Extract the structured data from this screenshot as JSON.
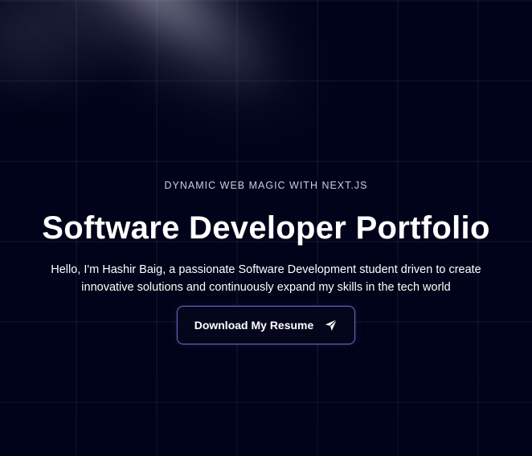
{
  "hero": {
    "eyebrow": "DYNAMIC WEB MAGIC WITH NEXT.JS",
    "title": "Software Developer Portfolio",
    "description": "Hello, I'm Hashir Baig, a passionate Software Development student driven to create innovative solutions and continuously expand my skills in the tech world",
    "cta_label": "Download My Resume",
    "cta_icon": "send-icon"
  },
  "colors": {
    "background": "#000319",
    "accent_border": "#6f63b8",
    "text_primary": "#ffffff",
    "text_muted": "#c9cfe6"
  }
}
